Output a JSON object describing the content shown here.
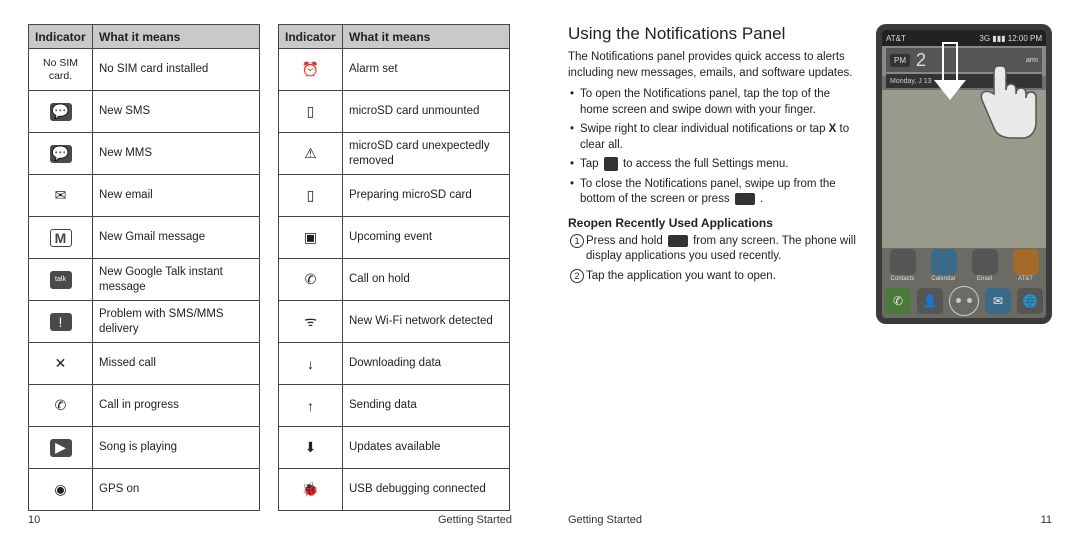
{
  "left_page": {
    "number": "10",
    "footer": "Getting Started",
    "headers": {
      "indicator": "Indicator",
      "meaning": "What it means"
    },
    "table1": [
      {
        "icon_text": "No SIM card.",
        "icon_glyph": "",
        "meaning": "No SIM card installed"
      },
      {
        "icon_glyph": "💬",
        "meaning": "New SMS"
      },
      {
        "icon_glyph": "💬",
        "meaning": "New MMS"
      },
      {
        "icon_glyph": "✉",
        "meaning": "New email"
      },
      {
        "icon_glyph": "M",
        "meaning": "New Gmail message"
      },
      {
        "icon_glyph": "talk",
        "meaning": "New Google Talk instant message"
      },
      {
        "icon_glyph": "!",
        "meaning": "Problem with SMS/MMS delivery"
      },
      {
        "icon_glyph": "✕",
        "meaning": "Missed call"
      },
      {
        "icon_glyph": "✆",
        "meaning": "Call in progress"
      },
      {
        "icon_glyph": "▶",
        "meaning": "Song is playing"
      },
      {
        "icon_glyph": "◉",
        "meaning": "GPS on"
      }
    ],
    "table2": [
      {
        "icon_glyph": "⏰",
        "meaning": "Alarm set"
      },
      {
        "icon_glyph": "▯",
        "meaning": "microSD card unmounted"
      },
      {
        "icon_glyph": "⚠",
        "meaning": "microSD card unexpectedly removed"
      },
      {
        "icon_glyph": "▯",
        "meaning": "Preparing microSD card"
      },
      {
        "icon_glyph": "▣",
        "meaning": "Upcoming event"
      },
      {
        "icon_glyph": "✆",
        "meaning": "Call on hold"
      },
      {
        "icon_glyph": "ᯤ",
        "meaning": "New Wi-Fi network detected"
      },
      {
        "icon_glyph": "↓",
        "meaning": "Downloading data"
      },
      {
        "icon_glyph": "↑",
        "meaning": "Sending data"
      },
      {
        "icon_glyph": "⬇",
        "meaning": "Updates available"
      },
      {
        "icon_glyph": "🐞",
        "meaning": "USB debugging connected"
      }
    ]
  },
  "right_page": {
    "number": "11",
    "footer": "Getting Started",
    "heading": "Using the Notifications Panel",
    "intro": "The Notifications panel provides quick access to alerts including new messages, emails, and software updates.",
    "bullets": {
      "b1": "To open the Notifications panel, tap the top of the home screen and swipe down with your finger.",
      "b2a": "Swipe right to clear individual notifications or tap ",
      "b2b": " to clear all.",
      "b2_icon": "X",
      "b3a": "Tap ",
      "b3b": " to access the full Settings menu.",
      "b4a": "To close the Notifications panel, swipe up from the bottom of the screen or press ",
      "b4b": " ."
    },
    "subheading": "Reopen Recently Used Applications",
    "steps": {
      "s1a": "Press and hold ",
      "s1b": " from any screen. The phone will display applications you used recently.",
      "s2": "Tap the application you want to open."
    },
    "phone": {
      "carrier": "AT&T",
      "time": "12:00 PM",
      "signal": "3G ▮▮▮",
      "pm": "PM",
      "big_time": "2",
      "alarm_suffix": "arm",
      "date": "Monday, J      13",
      "apps": [
        "Contacts",
        "Calendar",
        "Email",
        "AT&T"
      ]
    }
  }
}
